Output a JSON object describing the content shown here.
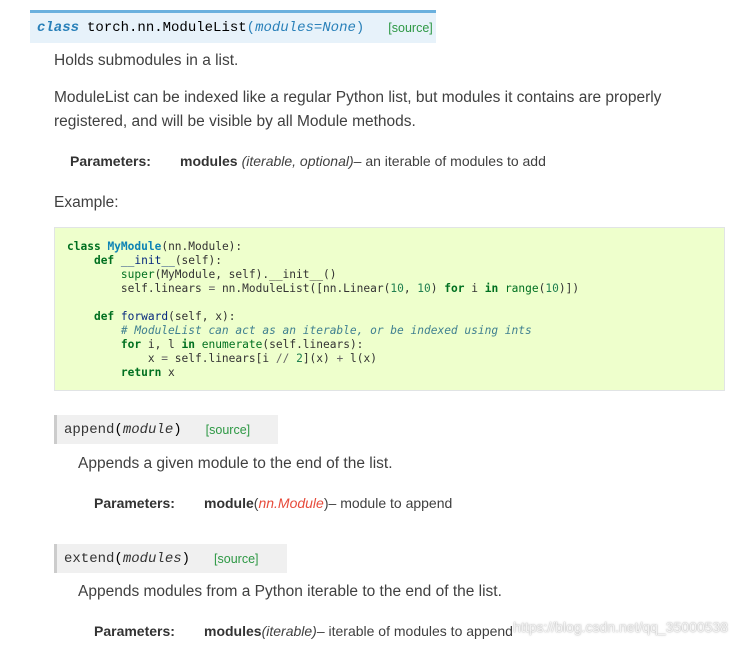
{
  "class_sig": {
    "keyword": "class",
    "name": "torch.nn.ModuleList",
    "open_paren": "(",
    "param": "modules=None",
    "close_paren": ")",
    "source": "[source]"
  },
  "intro": "Holds submodules in a list.",
  "description_line1": "ModuleList can be indexed like a regular Python list, but modules it contains are properly",
  "description_line2": "registered, and will be visible by all Module methods.",
  "class_params": {
    "label": "Parameters:",
    "name": "modules",
    "type": "(iterable, optional)",
    "desc": " – an iterable of modules to add"
  },
  "example_label": "Example:",
  "code_lines": [
    "class MyModule(nn.Module):",
    "    def __init__(self):",
    "        super(MyModule, self).__init__()",
    "        self.linears = nn.ModuleList([nn.Linear(10, 10) for i in range(10)])",
    "",
    "    def forward(self, x):",
    "        # ModuleList can act as an iterable, or be indexed using ints",
    "        for i, l in enumerate(self.linears):",
    "            x = self.linears[i // 2](x) + l(x)",
    "        return x"
  ],
  "append": {
    "name": "append",
    "open_paren": "(",
    "param": "module",
    "close_paren": ")",
    "source": "[source]",
    "description": "Appends a given module to the end of the list.",
    "params_label": "Parameters:",
    "param_name": "module",
    "param_type_open": " (",
    "param_type": "nn.Module",
    "param_type_close": ")",
    "param_desc": " – module to append"
  },
  "extend": {
    "name": "extend",
    "open_paren": "(",
    "param": "modules",
    "close_paren": ")",
    "source": "[source]",
    "description": "Appends modules from a Python iterable to the end of the list.",
    "params_label": "Parameters:",
    "param_name": "modules",
    "param_type": " (iterable)",
    "param_desc": " – iterable of modules to append"
  },
  "watermark": "https://blog.csdn.net/qq_35000538"
}
